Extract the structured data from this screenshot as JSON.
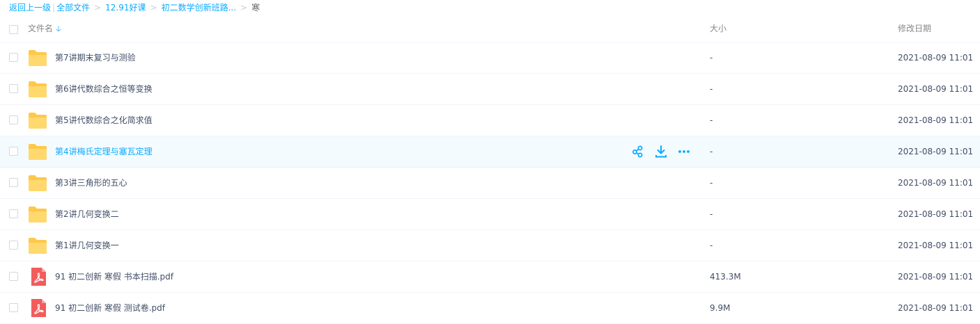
{
  "breadcrumb": {
    "back": "返回上一级",
    "sep": "|",
    "items": [
      "全部文件",
      "12.91好课",
      "初二数学创新班路..."
    ],
    "current": "寒"
  },
  "header": {
    "name": "文件名",
    "size": "大小",
    "date": "修改日期",
    "sort_icon": "arrow-down-icon"
  },
  "files": [
    {
      "name": "第7讲期末复习与测验",
      "type": "folder",
      "size": "-",
      "date": "2021-08-09 11:01"
    },
    {
      "name": "第6讲代数综合之恒等变换",
      "type": "folder",
      "size": "-",
      "date": "2021-08-09 11:01"
    },
    {
      "name": "第5讲代数综合之化简求值",
      "type": "folder",
      "size": "-",
      "date": "2021-08-09 11:01"
    },
    {
      "name": "第4讲梅氏定理与塞瓦定理",
      "type": "folder",
      "size": "-",
      "date": "2021-08-09 11:01",
      "hovered": true
    },
    {
      "name": "第3讲三角形的五心",
      "type": "folder",
      "size": "-",
      "date": "2021-08-09 11:01"
    },
    {
      "name": "第2讲几何变换二",
      "type": "folder",
      "size": "-",
      "date": "2021-08-09 11:01"
    },
    {
      "name": "第1讲几何变换一",
      "type": "folder",
      "size": "-",
      "date": "2021-08-09 11:01"
    },
    {
      "name": "91 初二创新 寒假 书本扫描.pdf",
      "type": "pdf",
      "size": "413.3M",
      "date": "2021-08-09 11:01"
    },
    {
      "name": "91 初二创新 寒假 测试卷.pdf",
      "type": "pdf",
      "size": "9.9M",
      "date": "2021-08-09 11:01"
    }
  ],
  "row_actions": [
    "share-icon",
    "download-icon",
    "more-icon"
  ],
  "colors": {
    "accent": "#09aaff",
    "folder": "#ffd36b",
    "pdf": "#f25c5c",
    "text": "#424e67"
  }
}
